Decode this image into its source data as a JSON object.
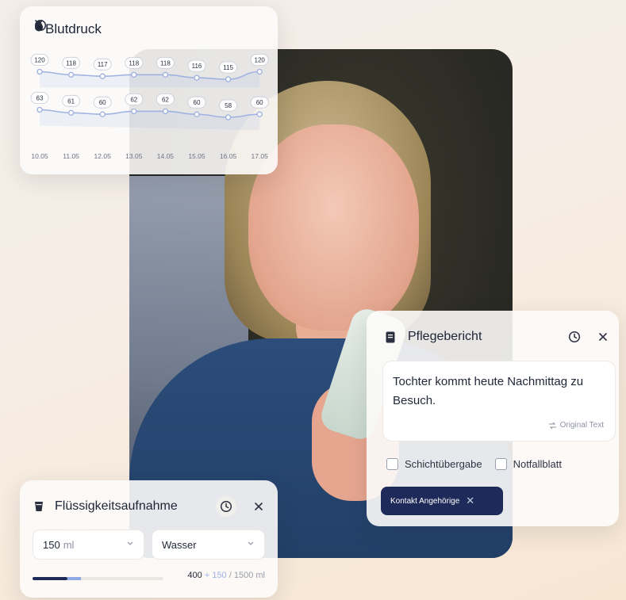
{
  "blutdruck": {
    "title": "Blutdruck",
    "icon": "drop-icon",
    "dates": [
      "10.05",
      "11.05",
      "12.05",
      "13.05",
      "14.05",
      "15.05",
      "16.05",
      "17.05"
    ],
    "systolic": [
      120,
      118,
      117,
      118,
      118,
      116,
      115,
      120
    ],
    "diastolic": [
      63,
      61,
      60,
      62,
      62,
      60,
      58,
      60
    ]
  },
  "pflegebericht": {
    "title": "Pflegebericht",
    "icon": "document-icon",
    "note": "Tochter kommt heute Nachmittag zu Besuch.",
    "original_label": "Original Text",
    "checkbox1": "Schichtübergabe",
    "checkbox2": "Notfallblatt",
    "chip": "Kontakt Angehörige"
  },
  "fluessigkeit": {
    "title": "Flüssigkeitsaufnahme",
    "icon": "cup-icon",
    "amount": "150",
    "amount_unit": "ml",
    "kind": "Wasser",
    "progress_current": "400",
    "progress_add": "+ 150",
    "progress_total": "/ 1500 ml",
    "progress_fraction": 0.3667,
    "current_fraction": 0.2667
  },
  "colors": {
    "accent": "#1e2a59",
    "line": "#9fb2e2",
    "progress_add": "#8fa8e6"
  }
}
